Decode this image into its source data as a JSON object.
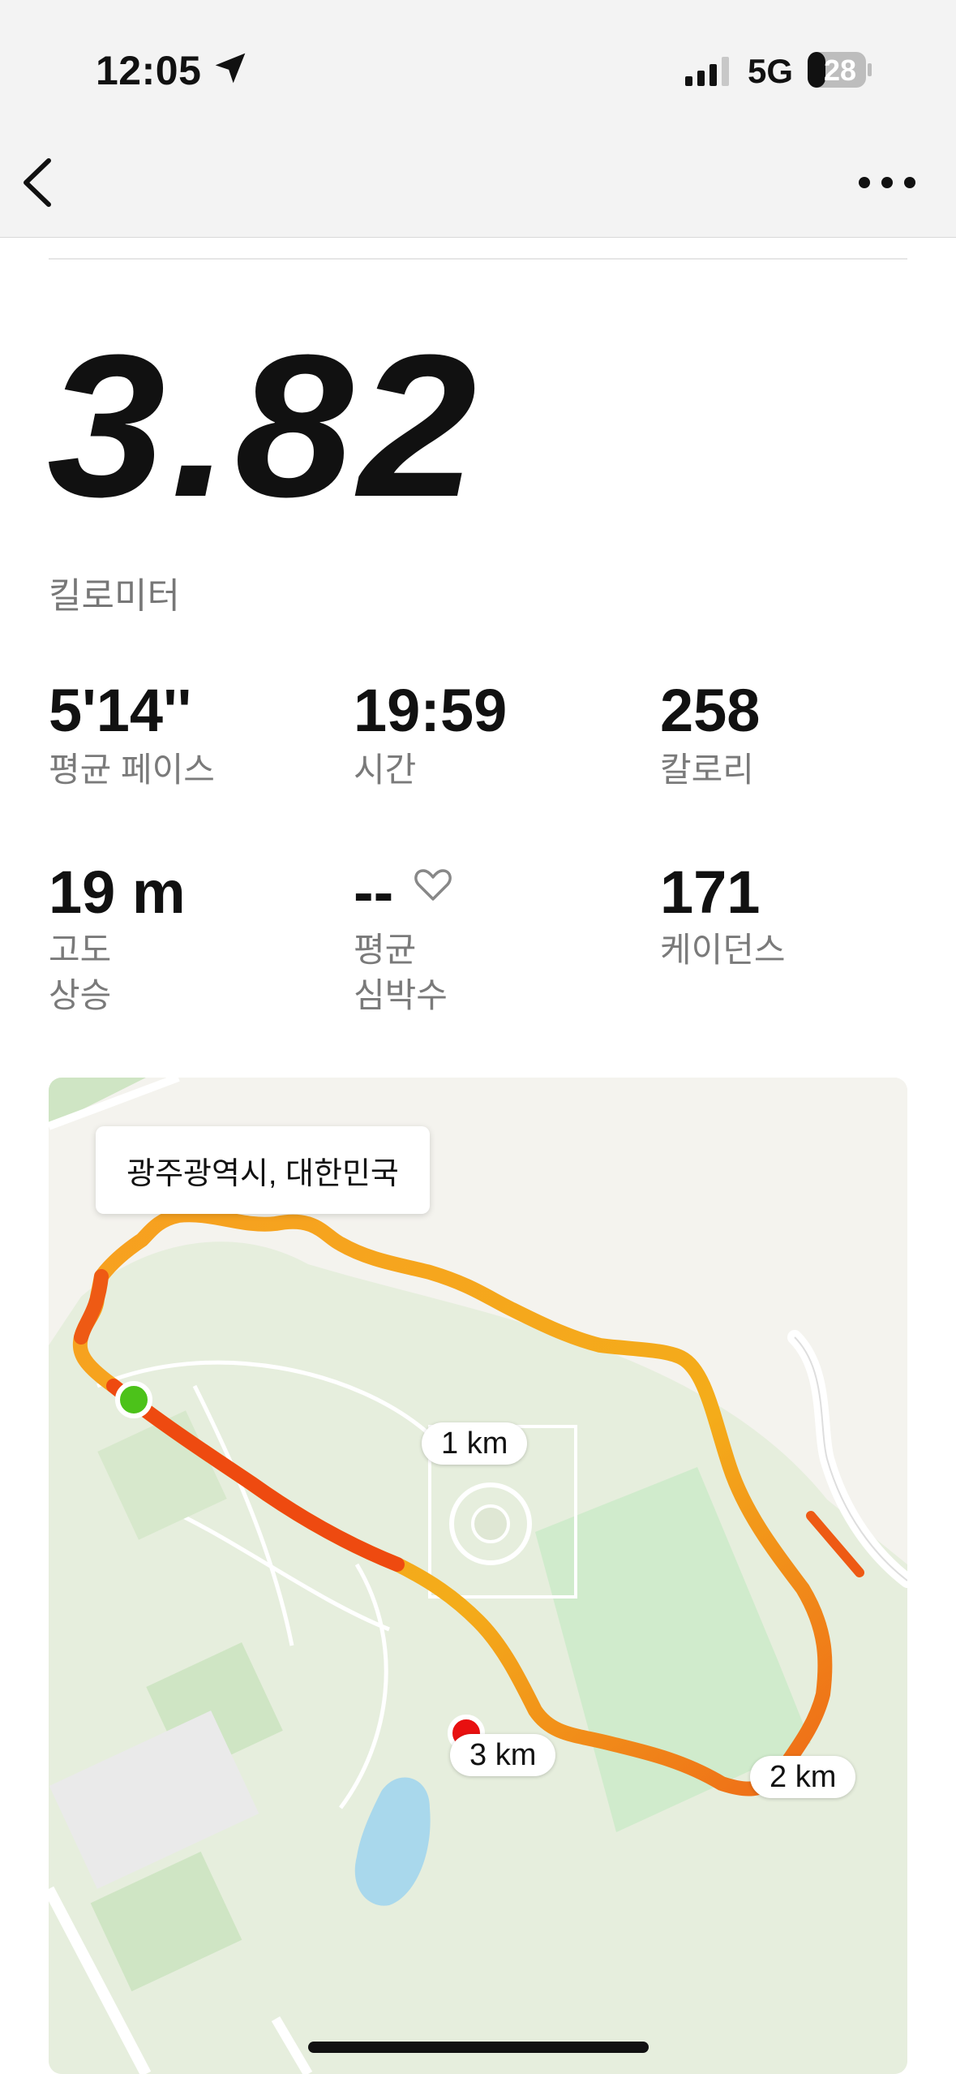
{
  "status_bar": {
    "time": "12:05",
    "network": "5G",
    "battery": "28"
  },
  "summary": {
    "distance": "3.82",
    "unit": "킬로미터"
  },
  "stats": [
    {
      "value": "5'14''",
      "label": "평균 페이스"
    },
    {
      "value": "19:59",
      "label": "시간"
    },
    {
      "value": "258",
      "label": "칼로리"
    },
    {
      "value": "19 m",
      "label1": "고도",
      "label2": "상승"
    },
    {
      "value": "--",
      "label1": "평균",
      "label2": "심박수"
    },
    {
      "value": "171",
      "label": "케이던스"
    }
  ],
  "map": {
    "location": "광주광역시, 대한민국",
    "markers": [
      "1 km",
      "2 km",
      "3 km"
    ]
  },
  "colors": {
    "route_start": "#f0a020",
    "route_end": "#ee4a10",
    "start_dot": "#4cc21a",
    "end_dot": "#e81010"
  }
}
